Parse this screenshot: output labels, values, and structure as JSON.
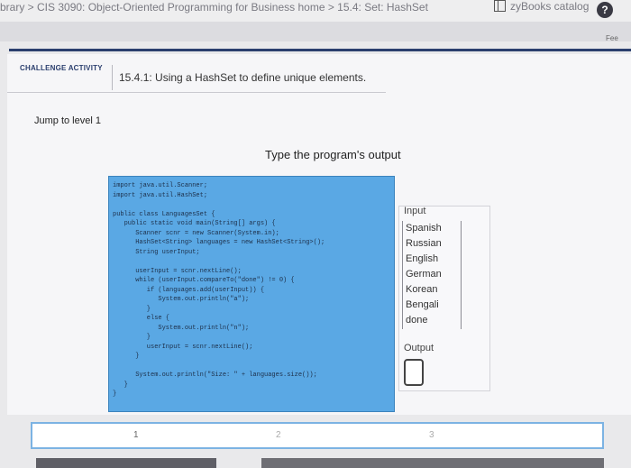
{
  "header": {
    "breadcrumb": "brary > CIS 3090: Object-Oriented Programming for Business home > 15.4: Set: HashSet",
    "catalog_label": "zyBooks catalog",
    "help_symbol": "?",
    "feed_label": "Fee"
  },
  "activity": {
    "label": "CHALLENGE ACTIVITY",
    "title": "15.4.1: Using a HashSet to define unique elements.",
    "jump": "Jump to level 1",
    "instruction": "Type the program's output"
  },
  "code": {
    "source": "import java.util.Scanner;\nimport java.util.HashSet;\n\npublic class LanguagesSet {\n   public static void main(String[] args) {\n      Scanner scnr = new Scanner(System.in);\n      HashSet<String> languages = new HashSet<String>();\n      String userInput;\n\n      userInput = scnr.nextLine();\n      while (userInput.compareTo(\"done\") != 0) {\n         if (languages.add(userInput)) {\n            System.out.println(\"a\");\n         }\n         else {\n            System.out.println(\"n\");\n         }\n         userInput = scnr.nextLine();\n      }\n\n      System.out.println(\"Size: \" + languages.size());\n   }\n}"
  },
  "io": {
    "input_heading": "Input",
    "input_lines": [
      "Spanish",
      "Russian",
      "English",
      "German",
      "Korean",
      "Bengali",
      "done"
    ],
    "output_heading": "Output",
    "output_value": ""
  },
  "levels": [
    "1",
    "2",
    "3"
  ],
  "colors": {
    "code_bg": "#5aa8e4",
    "accent": "#2b3f6e",
    "answer_border": "#7cb3e3"
  }
}
